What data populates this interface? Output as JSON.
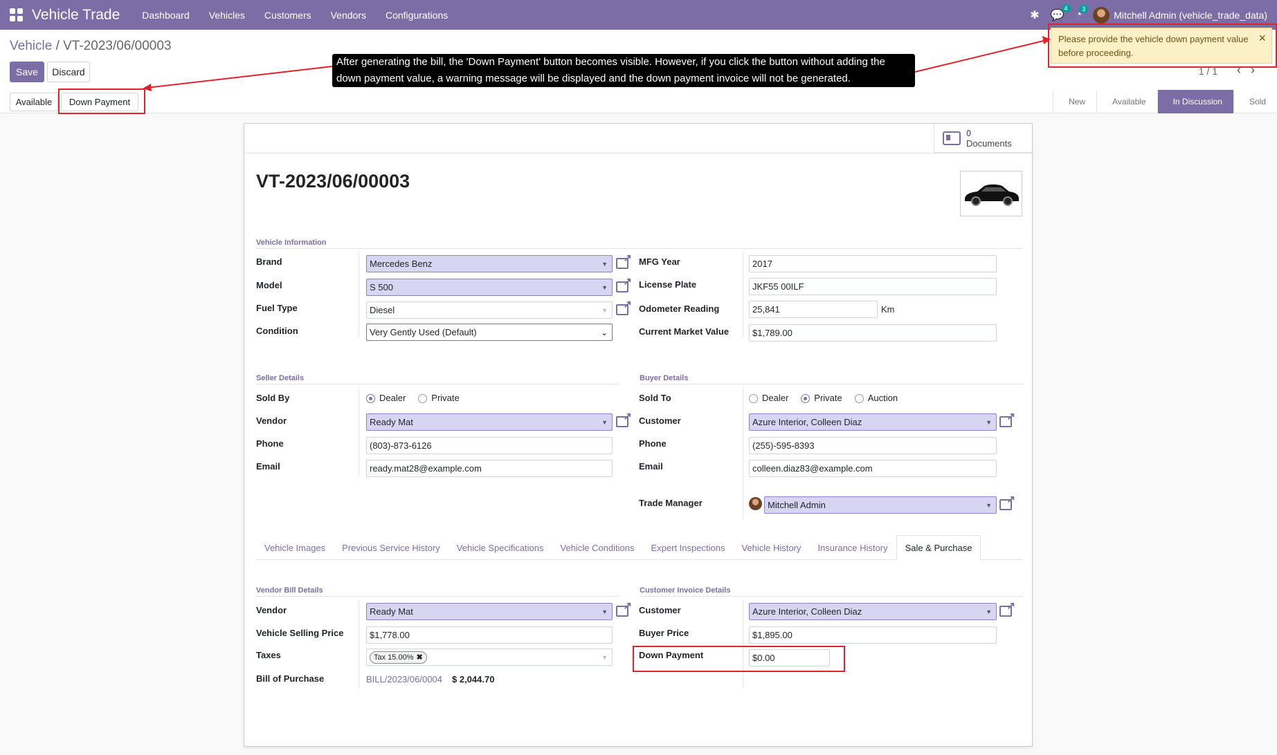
{
  "navbar": {
    "brand": "Vehicle Trade",
    "menu": [
      "Dashboard",
      "Vehicles",
      "Customers",
      "Vendors",
      "Configurations"
    ],
    "chat_count": "4",
    "activity_count": "3",
    "user": "Mitchell Admin (vehicle_trade_data)"
  },
  "breadcrumb": {
    "parent": "Vehicle",
    "separator": "/",
    "current": "VT-2023/06/00003"
  },
  "buttons": {
    "save": "Save",
    "discard": "Discard",
    "available": "Available",
    "down_payment": "Down Payment"
  },
  "pager": "1 / 1",
  "stages": [
    {
      "label": "New",
      "active": false
    },
    {
      "label": "Available",
      "active": false
    },
    {
      "label": "In Discussion",
      "active": true
    },
    {
      "label": "Sold",
      "active": false
    }
  ],
  "tooltip": "After generating the bill, the 'Down Payment' button becomes visible. However, if you click the button without adding the down payment value, a warning message will be displayed and the down payment invoice will not be generated.",
  "toast": "Please provide the vehicle down payment value before proceeding.",
  "documents": {
    "count": "0",
    "label": "Documents"
  },
  "record_title": "VT-2023/06/00003",
  "vehicle_info": {
    "title": "Vehicle Information",
    "brand_label": "Brand",
    "brand": "Mercedes Benz",
    "model_label": "Model",
    "model": "S 500",
    "fuel_label": "Fuel Type",
    "fuel": "Diesel",
    "condition_label": "Condition",
    "condition": "Very Gently Used (Default)",
    "year_label": "MFG Year",
    "year": "2017",
    "plate_label": "License Plate",
    "plate": "JKF55 00ILF",
    "odometer_label": "Odometer Reading",
    "odometer": "25,841",
    "odometer_unit": "Km",
    "market_label": "Current Market Value",
    "market": "$1,789.00"
  },
  "seller": {
    "title": "Seller Details",
    "sold_by_label": "Sold By",
    "options": [
      "Dealer",
      "Private"
    ],
    "vendor_label": "Vendor",
    "vendor": "Ready Mat",
    "phone_label": "Phone",
    "phone": "(803)-873-6126",
    "email_label": "Email",
    "email": "ready.mat28@example.com"
  },
  "buyer": {
    "title": "Buyer Details",
    "sold_to_label": "Sold To",
    "options": [
      "Dealer",
      "Private",
      "Auction"
    ],
    "customer_label": "Customer",
    "customer": "Azure Interior, Colleen Diaz",
    "phone_label": "Phone",
    "phone": "(255)-595-8393",
    "email_label": "Email",
    "email": "colleen.diaz83@example.com",
    "manager_label": "Trade Manager",
    "manager": "Mitchell Admin"
  },
  "tabs": [
    "Vehicle Images",
    "Previous Service History",
    "Vehicle Specifications",
    "Vehicle Conditions",
    "Expert Inspections",
    "Vehicle History",
    "Insurance History",
    "Sale & Purchase"
  ],
  "vendor_bill": {
    "title": "Vendor Bill Details",
    "vendor_label": "Vendor",
    "vendor": "Ready Mat",
    "price_label": "Vehicle Selling Price",
    "price": "$1,778.00",
    "taxes_label": "Taxes",
    "tax_tag": "Tax 15.00%",
    "bill_label": "Bill of Purchase",
    "bill_ref": "BILL/2023/06/0004",
    "bill_amount": "$ 2,044.70"
  },
  "customer_invoice": {
    "title": "Customer Invoice Details",
    "customer_label": "Customer",
    "customer": "Azure Interior, Colleen Diaz",
    "buyer_price_label": "Buyer Price",
    "buyer_price": "$1,895.00",
    "down_payment_label": "Down Payment",
    "down_payment": "$0.00"
  }
}
